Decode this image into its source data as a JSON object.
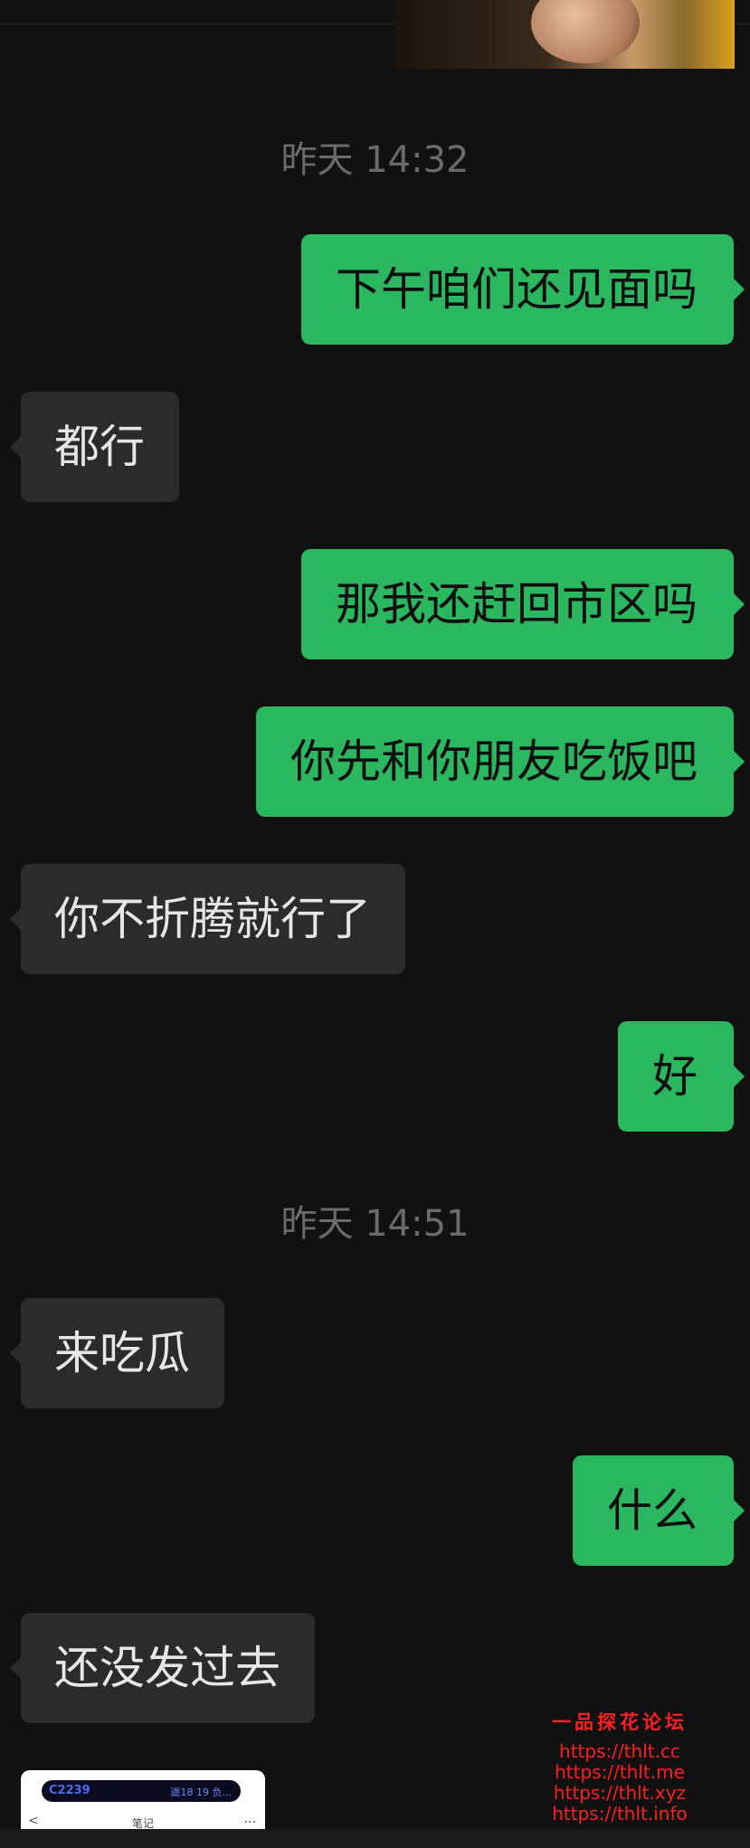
{
  "chat": {
    "timestamps": [
      "昨天 14:32",
      "昨天 14:51"
    ],
    "messages": [
      {
        "side": "out",
        "text": "下午咱们还见面吗"
      },
      {
        "side": "in",
        "text": "都行"
      },
      {
        "side": "out",
        "text": "那我还赶回市区吗"
      },
      {
        "side": "out",
        "text": "你先和你朋友吃饭吧"
      },
      {
        "side": "in",
        "text": "你不折腾就行了"
      },
      {
        "side": "out",
        "text": "好"
      },
      {
        "side": "in",
        "text": "来吃瓜"
      },
      {
        "side": "out",
        "text": "什么"
      },
      {
        "side": "in",
        "text": "还没发过去"
      }
    ]
  },
  "screenshot_thumb": {
    "pill_left": "C2239",
    "pill_right": "🈫18 19 负...",
    "back_icon": "<",
    "title": "笔记",
    "more_icon": "..."
  },
  "watermark": {
    "title": "一品探花论坛",
    "links": [
      "https://thlt.cc",
      "https://thlt.me",
      "https://thlt.xyz",
      "https://thlt.info"
    ]
  },
  "colors": {
    "background": "#111111",
    "outgoing_bubble": "#2bb760",
    "incoming_bubble": "#2b2b2b",
    "timestamp": "#6b6b6b",
    "watermark": "#ff2020"
  }
}
